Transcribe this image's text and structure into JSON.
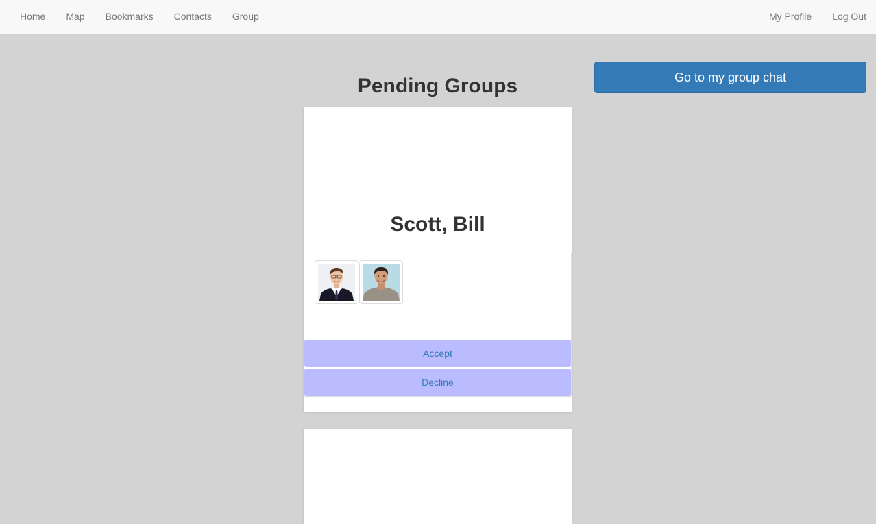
{
  "nav": {
    "left": [
      {
        "label": "Home"
      },
      {
        "label": "Map"
      },
      {
        "label": "Bookmarks"
      },
      {
        "label": "Contacts"
      },
      {
        "label": "Group"
      }
    ],
    "right": [
      {
        "label": "My Profile"
      },
      {
        "label": "Log Out"
      }
    ]
  },
  "main": {
    "title": "Pending Groups",
    "chat_button_label": "Go to my group chat",
    "groups": [
      {
        "name": "Scott, Bill",
        "members": [
          {
            "avatar": "photo-man-in-suit"
          },
          {
            "avatar": "photo-man-in-tshirt"
          }
        ],
        "accept_label": "Accept",
        "decline_label": "Decline"
      }
    ]
  },
  "colors": {
    "page_bg": "#d3d3d3",
    "navbar_bg": "#f8f8f8",
    "primary_button": "#337ab7",
    "action_button_bg": "#bbbbff",
    "link_text": "#337ab7"
  }
}
